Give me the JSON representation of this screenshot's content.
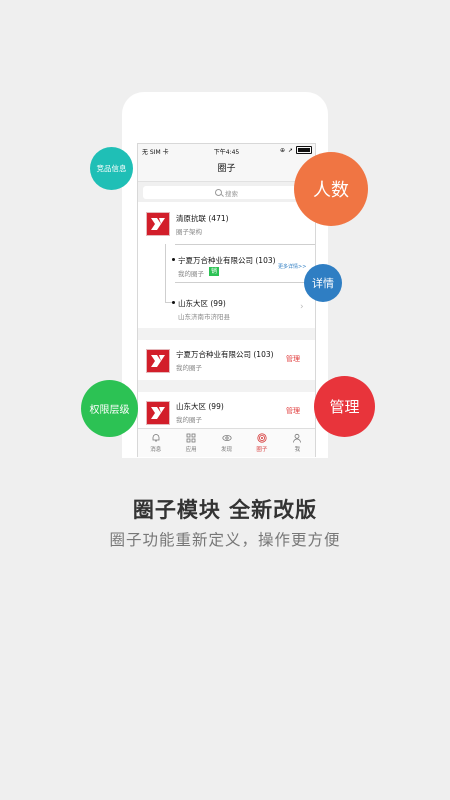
{
  "status_bar": {
    "carrier": "无 SIM 卡",
    "time": "下午4:45"
  },
  "nav": {
    "title": "圈子"
  },
  "search": {
    "placeholder": "搜索"
  },
  "circle_tree": {
    "root": {
      "name": "清原抗联 (471)",
      "sub": "圈子架构"
    },
    "child1": {
      "name": "宁夏万合种业有限公司 (103)",
      "sub": "我的圈子",
      "badge": "销",
      "more": "更多详情>>"
    },
    "child2": {
      "name": "山东大区 (99)",
      "sub": "山东济南市济阳县"
    }
  },
  "list": [
    {
      "name": "宁夏万合种业有限公司 (103)",
      "sub": "我的圈子",
      "action": "管理"
    },
    {
      "name": "山东大区 (99)",
      "sub": "我的圈子",
      "action": "管理"
    }
  ],
  "tabs": [
    {
      "label": "消息",
      "icon": "bell-icon"
    },
    {
      "label": "应用",
      "icon": "apps-grid-icon"
    },
    {
      "label": "发现",
      "icon": "eye-icon"
    },
    {
      "label": "圈子",
      "icon": "circle-target-icon",
      "active": true
    },
    {
      "label": "我",
      "icon": "person-icon"
    }
  ],
  "bubbles": {
    "competitor": "竞品信息",
    "count": "人数",
    "detail": "详情",
    "permission": "权限层级",
    "manage": "管理"
  },
  "colors": {
    "green": "#2cc254",
    "orange": "#f07543",
    "blue": "#2f7ec3",
    "red": "#e8343b",
    "teal": "#1fbfb6",
    "brand_red": "#d21e2a"
  },
  "headline": "圈子模块 全新改版",
  "subline": "圈子功能重新定义，操作更方便"
}
